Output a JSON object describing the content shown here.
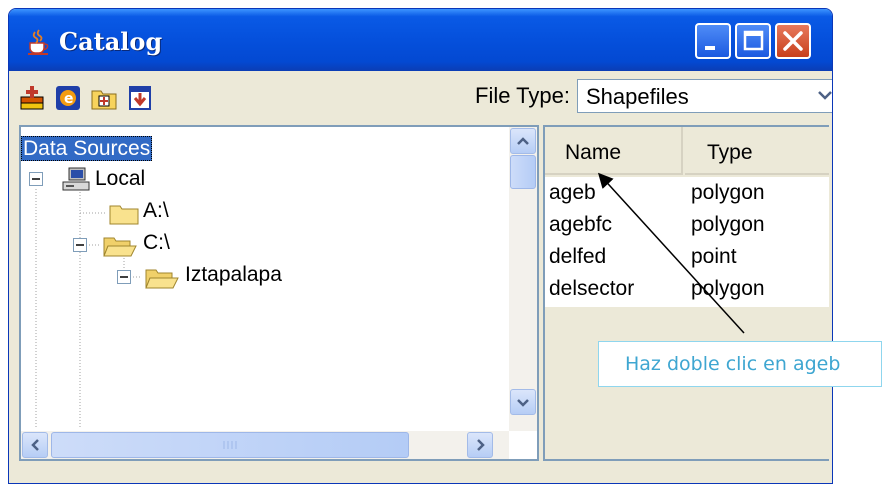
{
  "window": {
    "title": "Catalog"
  },
  "toolbar": {
    "icons": [
      "add-data-icon",
      "connect-icon",
      "new-folder-icon",
      "disconnect-icon"
    ],
    "file_type_label": "File Type:",
    "file_type_value": "Shapefiles"
  },
  "tree": {
    "root": "Data Sources",
    "local": "Local",
    "drive_a": "A:\\",
    "drive_c": "C:\\",
    "folder": "Iztapalapa"
  },
  "list": {
    "columns": [
      "Name",
      "Type"
    ],
    "rows": [
      {
        "name": "ageb",
        "type": "polygon"
      },
      {
        "name": "agebfc",
        "type": "polygon"
      },
      {
        "name": "delfed",
        "type": "point"
      },
      {
        "name": "delsector",
        "type": "polygon"
      }
    ]
  },
  "callout": {
    "text": "Haz doble clic en ageb"
  },
  "colors": {
    "titlebar": "#0550dc",
    "selection": "#316ac5",
    "callout_text": "#3ea6d1"
  }
}
